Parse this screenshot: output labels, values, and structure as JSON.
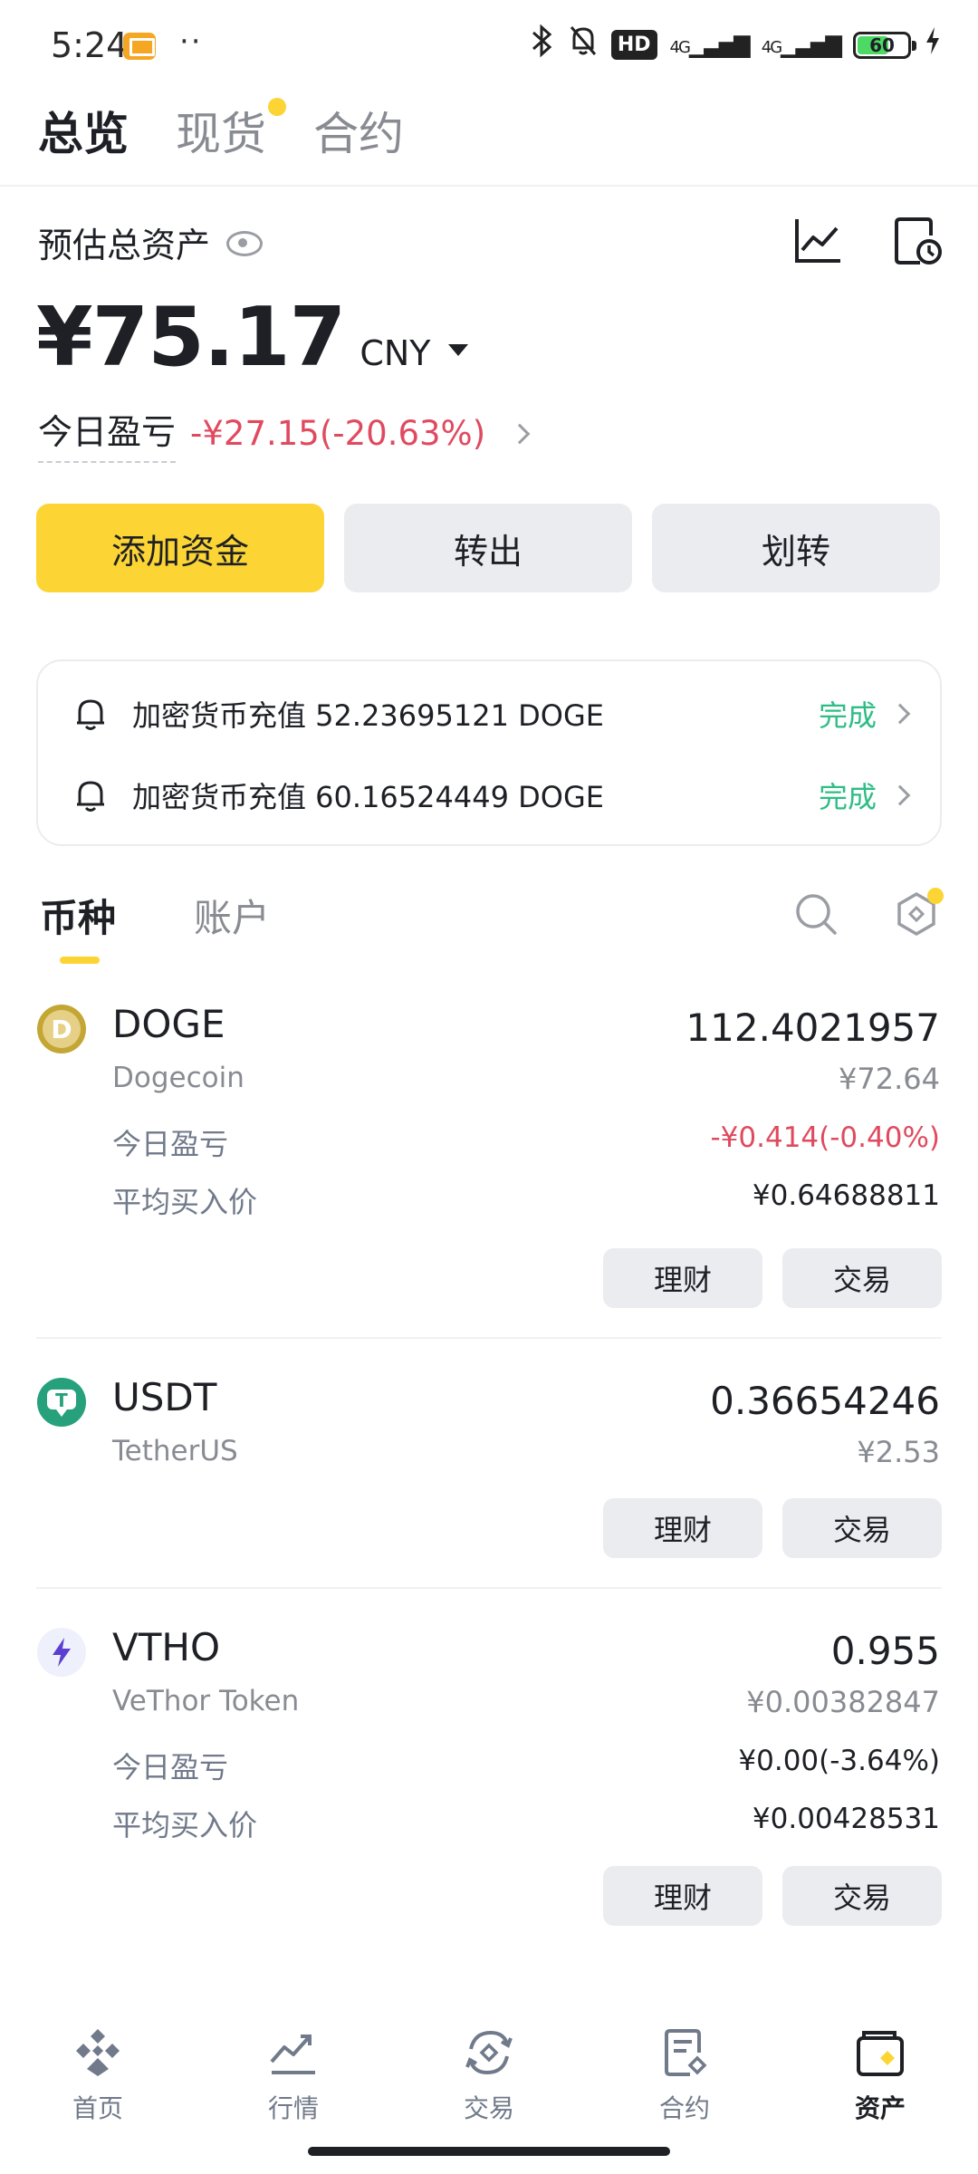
{
  "status_bar": {
    "time": "5:24",
    "dots": "··",
    "hd": "HD",
    "signal1": "4G",
    "signal2": "4G",
    "battery": "60"
  },
  "top_tabs": [
    {
      "label": "总览",
      "active": true
    },
    {
      "label": "现货",
      "active": false
    },
    {
      "label": "合约",
      "active": false
    }
  ],
  "header": {
    "est_label": "预估总资产",
    "balance": "¥75.17",
    "currency": "CNY",
    "pnl_label": "今日盈亏",
    "pnl_value": "-¥27.15(-20.63%)"
  },
  "actions": {
    "add": "添加资金",
    "withdraw": "转出",
    "transfer": "划转"
  },
  "notices": [
    {
      "text": "加密货币充值 52.23695121 DOGE",
      "status": "完成"
    },
    {
      "text": "加密货币充值 60.16524449 DOGE",
      "status": "完成"
    }
  ],
  "asset_tabs": [
    {
      "label": "币种",
      "active": true
    },
    {
      "label": "账户",
      "active": false
    }
  ],
  "coins": [
    {
      "symbol": "DOGE",
      "name": "Dogecoin",
      "amount": "112.4021957",
      "value": "¥72.64",
      "pnl_label": "今日盈亏",
      "pnl": "-¥0.414(-0.40%)",
      "avg_label": "平均买入价",
      "avg": "¥0.64688811",
      "btn_earn": "理财",
      "btn_trade": "交易"
    },
    {
      "symbol": "USDT",
      "name": "TetherUS",
      "amount": "0.36654246",
      "value": "¥2.53",
      "btn_earn": "理财",
      "btn_trade": "交易"
    },
    {
      "symbol": "VTHO",
      "name": "VeThor Token",
      "amount": "0.955",
      "value": "¥0.00382847",
      "pnl_label": "今日盈亏",
      "pnl": "¥0.00(-3.64%)",
      "avg_label": "平均买入价",
      "avg": "¥0.00428531",
      "btn_earn": "理财",
      "btn_trade": "交易"
    }
  ],
  "bottom_nav": [
    {
      "label": "首页",
      "icon": "home-icon"
    },
    {
      "label": "行情",
      "icon": "markets-icon"
    },
    {
      "label": "交易",
      "icon": "trade-icon"
    },
    {
      "label": "合约",
      "icon": "futures-icon"
    },
    {
      "label": "资产",
      "icon": "wallet-icon",
      "active": true
    }
  ],
  "colors": {
    "accent": "#fcd535",
    "negative": "#e04a5f",
    "positive": "#2ebd85"
  }
}
